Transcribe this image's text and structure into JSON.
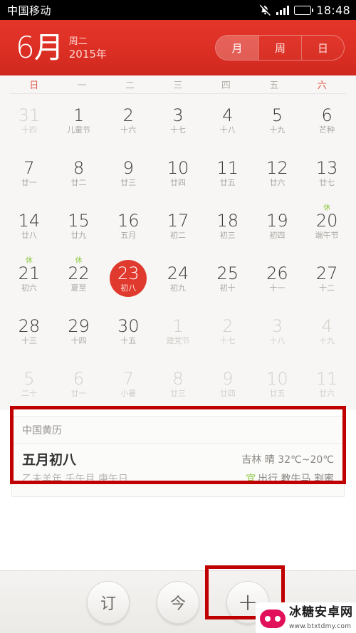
{
  "statusbar": {
    "carrier": "中国移动",
    "time": "18:48",
    "mute_icon": "bell-muted-icon",
    "signal_icon": "signal-bars-icon",
    "battery_icon": "battery-icon"
  },
  "header": {
    "month": "6月",
    "weekday": "周二",
    "year": "2015年",
    "views": [
      {
        "label": "月",
        "active": true
      },
      {
        "label": "周",
        "active": false
      },
      {
        "label": "日",
        "active": false
      }
    ]
  },
  "calendar": {
    "weekdays": [
      {
        "label": "日",
        "weekend": true
      },
      {
        "label": "一",
        "weekend": false
      },
      {
        "label": "二",
        "weekend": false
      },
      {
        "label": "三",
        "weekend": false
      },
      {
        "label": "四",
        "weekend": false
      },
      {
        "label": "五",
        "weekend": false
      },
      {
        "label": "六",
        "weekend": true
      }
    ],
    "days": [
      {
        "solar": "31",
        "lunar": "十四",
        "other": true,
        "today": false,
        "rest": ""
      },
      {
        "solar": "1",
        "lunar": "儿童节",
        "other": false,
        "today": false,
        "rest": ""
      },
      {
        "solar": "2",
        "lunar": "十六",
        "other": false,
        "today": false,
        "rest": ""
      },
      {
        "solar": "3",
        "lunar": "十七",
        "other": false,
        "today": false,
        "rest": ""
      },
      {
        "solar": "4",
        "lunar": "十八",
        "other": false,
        "today": false,
        "rest": ""
      },
      {
        "solar": "5",
        "lunar": "十九",
        "other": false,
        "today": false,
        "rest": ""
      },
      {
        "solar": "6",
        "lunar": "芒种",
        "other": false,
        "today": false,
        "rest": ""
      },
      {
        "solar": "7",
        "lunar": "廿一",
        "other": false,
        "today": false,
        "rest": ""
      },
      {
        "solar": "8",
        "lunar": "廿二",
        "other": false,
        "today": false,
        "rest": ""
      },
      {
        "solar": "9",
        "lunar": "廿三",
        "other": false,
        "today": false,
        "rest": ""
      },
      {
        "solar": "10",
        "lunar": "廿四",
        "other": false,
        "today": false,
        "rest": ""
      },
      {
        "solar": "11",
        "lunar": "廿五",
        "other": false,
        "today": false,
        "rest": ""
      },
      {
        "solar": "12",
        "lunar": "廿六",
        "other": false,
        "today": false,
        "rest": ""
      },
      {
        "solar": "13",
        "lunar": "廿七",
        "other": false,
        "today": false,
        "rest": ""
      },
      {
        "solar": "14",
        "lunar": "廿八",
        "other": false,
        "today": false,
        "rest": ""
      },
      {
        "solar": "15",
        "lunar": "廿九",
        "other": false,
        "today": false,
        "rest": ""
      },
      {
        "solar": "16",
        "lunar": "五月",
        "other": false,
        "today": false,
        "rest": ""
      },
      {
        "solar": "17",
        "lunar": "初二",
        "other": false,
        "today": false,
        "rest": ""
      },
      {
        "solar": "18",
        "lunar": "初三",
        "other": false,
        "today": false,
        "rest": ""
      },
      {
        "solar": "19",
        "lunar": "初四",
        "other": false,
        "today": false,
        "rest": ""
      },
      {
        "solar": "20",
        "lunar": "端午节",
        "other": false,
        "today": false,
        "rest": "休"
      },
      {
        "solar": "21",
        "lunar": "初六",
        "other": false,
        "today": false,
        "rest": "休"
      },
      {
        "solar": "22",
        "lunar": "夏至",
        "other": false,
        "today": false,
        "rest": "休"
      },
      {
        "solar": "23",
        "lunar": "初八",
        "other": false,
        "today": true,
        "rest": ""
      },
      {
        "solar": "24",
        "lunar": "初九",
        "other": false,
        "today": false,
        "rest": ""
      },
      {
        "solar": "25",
        "lunar": "初十",
        "other": false,
        "today": false,
        "rest": ""
      },
      {
        "solar": "26",
        "lunar": "十一",
        "other": false,
        "today": false,
        "rest": ""
      },
      {
        "solar": "27",
        "lunar": "十二",
        "other": false,
        "today": false,
        "rest": ""
      },
      {
        "solar": "28",
        "lunar": "十三",
        "other": false,
        "today": false,
        "rest": ""
      },
      {
        "solar": "29",
        "lunar": "十四",
        "other": false,
        "today": false,
        "rest": ""
      },
      {
        "solar": "30",
        "lunar": "十五",
        "other": false,
        "today": false,
        "rest": ""
      },
      {
        "solar": "1",
        "lunar": "建党节",
        "other": true,
        "today": false,
        "rest": ""
      },
      {
        "solar": "2",
        "lunar": "十七",
        "other": true,
        "today": false,
        "rest": ""
      },
      {
        "solar": "3",
        "lunar": "十八",
        "other": true,
        "today": false,
        "rest": ""
      },
      {
        "solar": "4",
        "lunar": "十九",
        "other": true,
        "today": false,
        "rest": ""
      },
      {
        "solar": "5",
        "lunar": "二十",
        "other": true,
        "today": false,
        "rest": ""
      },
      {
        "solar": "6",
        "lunar": "廿一",
        "other": true,
        "today": false,
        "rest": ""
      },
      {
        "solar": "7",
        "lunar": "小暑",
        "other": true,
        "today": false,
        "rest": ""
      },
      {
        "solar": "8",
        "lunar": "廿三",
        "other": true,
        "today": false,
        "rest": ""
      },
      {
        "solar": "9",
        "lunar": "廿四",
        "other": true,
        "today": false,
        "rest": ""
      },
      {
        "solar": "10",
        "lunar": "廿五",
        "other": true,
        "today": false,
        "rest": ""
      },
      {
        "solar": "11",
        "lunar": "廿六",
        "other": true,
        "today": false,
        "rest": ""
      }
    ]
  },
  "card": {
    "title": "中国黄历",
    "lunar_date": "五月初八",
    "ganzhi": "乙未羊年 壬午月 庚午日",
    "weather": "吉林 晴 32℃~20℃",
    "yi_badge": "宜",
    "yi_items": "出行 教牛马 割蜜"
  },
  "bottombar": {
    "buttons": [
      {
        "label": "订",
        "name": "subscribe-button"
      },
      {
        "label": "今",
        "name": "today-button"
      },
      {
        "label": "+",
        "name": "add-event-button"
      }
    ]
  },
  "watermark": {
    "site": "冰糖安卓网",
    "url": "www.btxtdmy.com"
  },
  "colors": {
    "brand_red": "#dc2f24",
    "today_red": "#e03a2e",
    "rest_green": "#8cc63e",
    "annotation_red": "#c00000"
  }
}
